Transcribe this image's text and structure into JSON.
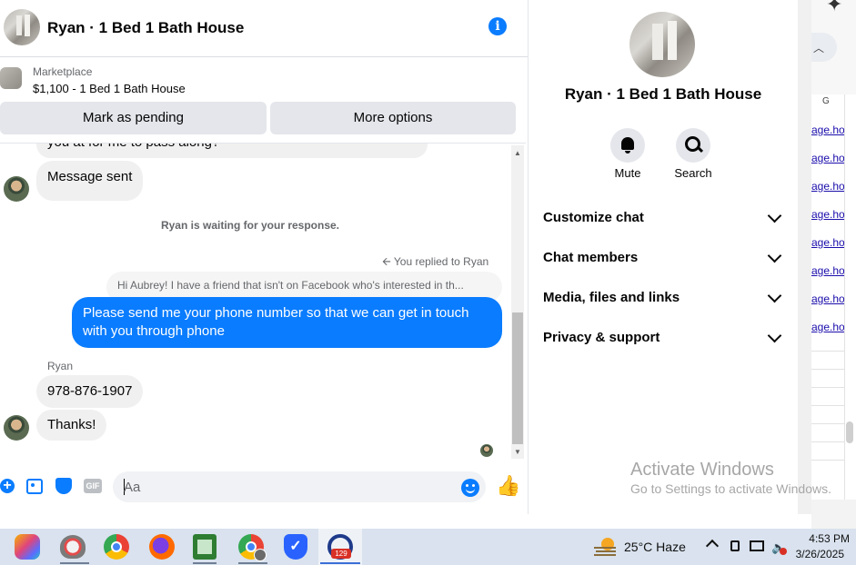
{
  "chat": {
    "title": "Ryan · 1 Bed 1 Bath House",
    "marketplace_label": "Marketplace",
    "listing": "$1,100 - 1 Bed 1 Bath House",
    "mark_pending": "Mark as pending",
    "more_options": "More options"
  },
  "messages": {
    "partial_top": "you at for me to pass along?",
    "message_sent": "Message sent",
    "waiting": "Ryan is waiting for your response.",
    "replied_to": "You replied to Ryan",
    "quoted": "Hi Aubrey! I have a friend that isn't on Facebook who's interested in th...",
    "outgoing_line1": "Please send me your phone  number so that we can get in touch",
    "outgoing_line2": "with you through phone",
    "sender_name": "Ryan",
    "phone": "978-876-1907",
    "thanks": "Thanks!"
  },
  "composer": {
    "placeholder": "Aa",
    "gif_label": "GIF"
  },
  "panel": {
    "title": "Ryan · 1 Bed 1 Bath House",
    "mute": "Mute",
    "search": "Search",
    "sections": [
      "Customize chat",
      "Chat members",
      "Media, files and links",
      "Privacy & support"
    ]
  },
  "sheet": {
    "col_header": "G",
    "links": [
      "age.ho",
      "age.ho",
      "age.ho",
      "age.ho",
      "age.ho",
      "age.ho",
      "age.ho",
      "age.ho"
    ]
  },
  "watermark": {
    "line1": "Activate Windows",
    "line2": "Go to Settings to activate Windows."
  },
  "taskbar": {
    "badge": "129",
    "weather": "25°C  Haze",
    "time": "4:53 PM",
    "date": "3/26/2025"
  },
  "colors": {
    "accent": "#0a7cff",
    "bubble_in": "#f0f0f0",
    "button_gray": "#e4e6eb",
    "taskbar": "#d9e2ee"
  }
}
